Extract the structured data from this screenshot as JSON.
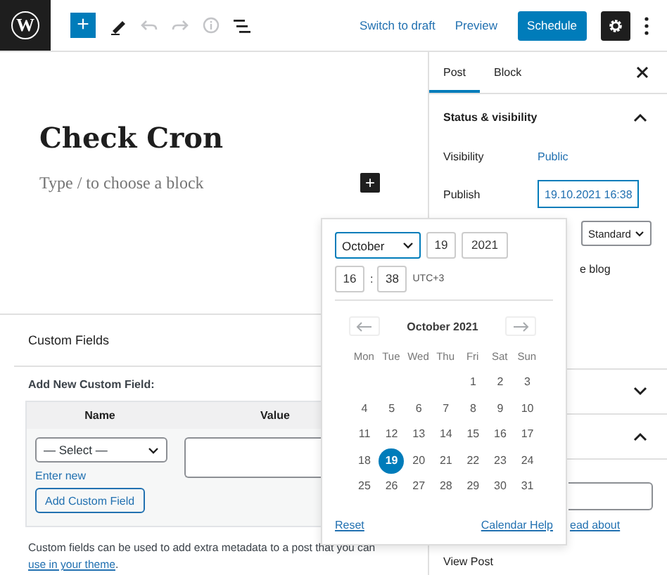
{
  "toolbar": {
    "logo": "W",
    "add": "+",
    "actions": [
      {
        "label": "Switch to draft",
        "kind": "link"
      },
      {
        "label": "Preview",
        "kind": "link"
      },
      {
        "label": "Schedule",
        "kind": "primary"
      }
    ]
  },
  "editor": {
    "title": "Check Cron",
    "placeholder": "Type / to choose a block",
    "inserter": "+"
  },
  "custom_fields": {
    "title": "Custom Fields",
    "subtitle": "Add New Custom Field:",
    "columns": [
      "Name",
      "Value"
    ],
    "select": "— Select —",
    "enter_new": "Enter new",
    "add_button": "Add Custom Field",
    "description": "Custom fields can be used to add extra metadata to a post that you can ",
    "description_link": "use in your theme",
    "description_end": "."
  },
  "sidebar": {
    "tabs": [
      {
        "label": "Post",
        "selected": true
      },
      {
        "label": "Block",
        "selected": false
      }
    ],
    "status_panel": {
      "title": "Status & visibility",
      "expanded": true,
      "visibility_label": "Visibility",
      "visibility_value": "Public",
      "publish_label": "Publish",
      "publish_value": "19.10.2021 16:38",
      "format": "Standard",
      "sticky_text": "e blog"
    },
    "panels": [
      {
        "expanded": false
      },
      {
        "expanded": true
      }
    ],
    "link_text": "ead about",
    "view_post": "View Post"
  },
  "date_picker": {
    "month": "October",
    "day": "19",
    "year": "2021",
    "hour": "16",
    "minute": "38",
    "separator": ":",
    "timezone": "UTC+3",
    "heading": "October 2021",
    "weekdays": [
      "Mon",
      "Tue",
      "Wed",
      "Thu",
      "Fri",
      "Sat",
      "Sun"
    ],
    "weeks": [
      [
        {
          "label": "1",
          "selected": false
        },
        {
          "label": "2",
          "selected": false
        },
        {
          "label": "3",
          "selected": false
        }
      ],
      [
        {
          "label": "4",
          "selected": false
        },
        {
          "label": "5",
          "selected": false
        },
        {
          "label": "6",
          "selected": false
        },
        {
          "label": "7",
          "selected": false
        },
        {
          "label": "8",
          "selected": false
        },
        {
          "label": "9",
          "selected": false
        },
        {
          "label": "10",
          "selected": false
        }
      ],
      [
        {
          "label": "11",
          "selected": false
        },
        {
          "label": "12",
          "selected": false
        },
        {
          "label": "13",
          "selected": false
        },
        {
          "label": "14",
          "selected": false
        },
        {
          "label": "15",
          "selected": false
        },
        {
          "label": "16",
          "selected": false
        },
        {
          "label": "17",
          "selected": false
        }
      ],
      [
        {
          "label": "18",
          "selected": false
        },
        {
          "label": "19",
          "selected": true
        },
        {
          "label": "20",
          "selected": false
        },
        {
          "label": "21",
          "selected": false
        },
        {
          "label": "22",
          "selected": false
        },
        {
          "label": "23",
          "selected": false
        },
        {
          "label": "24",
          "selected": false
        }
      ],
      [
        {
          "label": "25",
          "selected": false
        },
        {
          "label": "26",
          "selected": false
        },
        {
          "label": "27",
          "selected": false
        },
        {
          "label": "28",
          "selected": false
        },
        {
          "label": "29",
          "selected": false
        },
        {
          "label": "30",
          "selected": false
        },
        {
          "label": "31",
          "selected": false
        }
      ]
    ],
    "reset": "Reset",
    "help": "Calendar Help"
  }
}
